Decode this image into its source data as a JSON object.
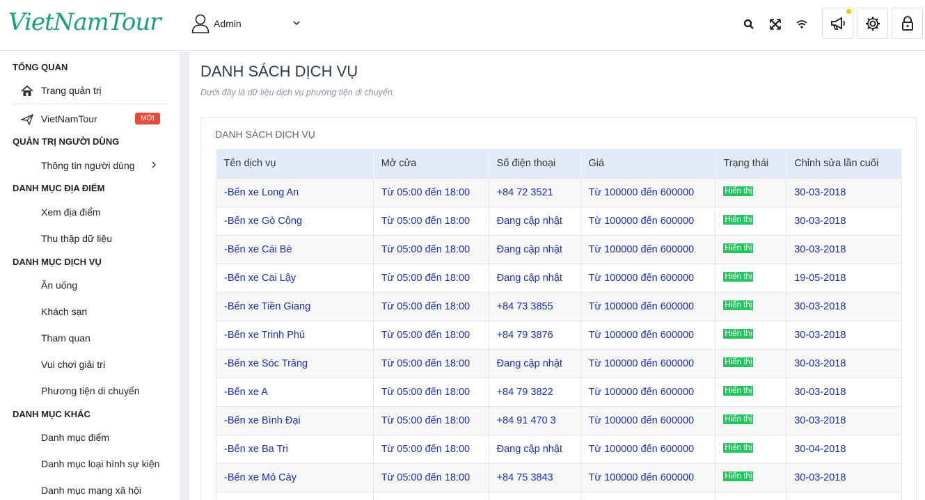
{
  "header": {
    "logo": "VietNamTour",
    "user_name": "Admin",
    "icons": [
      "search-icon",
      "fullscreen-icon",
      "wifi-icon",
      "megaphone-icon",
      "settings-icon",
      "lock-icon"
    ],
    "notif_color": "#f2c400"
  },
  "sidebar": {
    "sections": {
      "overview": "TỔNG QUAN",
      "users": "QUẢN TRỊ NGƯỜI DÙNG",
      "places": "DANH MỤC ĐỊA ĐIỂM",
      "services": "DANH MỤC DỊCH VỤ",
      "other": "DANH MỤC KHÁC"
    },
    "items": {
      "dashboard": "Trang quản trị",
      "vietnamtour": "VietNamTour",
      "new_badge": "MỚI",
      "user_info": "Thông tin người dùng",
      "view_places": "Xem địa điểm",
      "collect_data": "Thu thập dữ liệu",
      "food": "Ăn uống",
      "hotel": "Khách sạn",
      "sightseeing": "Tham quan",
      "entertainment": "Vui chơi giải trí",
      "transport": "Phương tiện di chuyển",
      "points": "Danh mục điểm",
      "event_types": "Danh mục loại hình sự kiện",
      "social": "Danh mục mạng xã hội"
    }
  },
  "main": {
    "title": "DANH SÁCH DỊCH VỤ",
    "subtitle": "Dưới đây là dữ liệu dịch vụ phương tiện di chuyển.",
    "card_title": "DANH SÁCH DỊCH VỤ",
    "columns": [
      "Tên dịch vụ",
      "Mở cửa",
      "Số điện thoại",
      "Giá",
      "Trạng thái",
      "Chỉnh sửa lần cuối"
    ],
    "rows": [
      [
        "-Bến xe Long An",
        "Từ 05:00 đến 18:00",
        "+84 72 3521",
        "Từ 100000 đến 600000",
        "Hiển thị",
        "30-03-2018"
      ],
      [
        "-Bến xe Gò Công",
        "Từ 05:00 đến 18:00",
        "Đang cập nhật",
        "Từ 100000 đến 600000",
        "Hiển thị",
        "30-03-2018"
      ],
      [
        "-Bến xe Cái Bè",
        "Từ 05:00 đến 18:00",
        "Đang cập nhật",
        "Từ 100000 đến 600000",
        "Hiển thị",
        "30-03-2018"
      ],
      [
        "-Bến xe Cai Lậy",
        "Từ 05:00 đến 18:00",
        "Đang cập nhật",
        "Từ 100000 đến 600000",
        "Hiển thị",
        "19-05-2018"
      ],
      [
        "-Bến xe Tiền Giang",
        "Từ 05:00 đến 18:00",
        "+84 73 3855",
        "Từ 100000 đến 600000",
        "Hiển thị",
        "30-03-2018"
      ],
      [
        "-Bến xe Trinh Phú",
        "Từ 05:00 đến 18:00",
        "+84 79 3876",
        "Từ 100000 đến 600000",
        "Hiển thị",
        "30-03-2018"
      ],
      [
        "-Bến xe Sóc Trăng",
        "Từ 05:00 đến 18:00",
        "Đang cập nhật",
        "Từ 100000 đến 600000",
        "Hiển thị",
        "30-03-2018"
      ],
      [
        "-Bến xe A",
        "Từ 05:00 đến 18:00",
        "+84 79 3822",
        "Từ 100000 đến 600000",
        "Hiển thị",
        "30-03-2018"
      ],
      [
        "-Bến xe Bình Đại",
        "Từ 05:00 đến 18:00",
        "+84 91 470 3",
        "Từ 100000 đến 600000",
        "Hiển thị",
        "30-03-2018"
      ],
      [
        "-Bến xe Ba Tri",
        "Từ 05:00 đến 18:00",
        "Đang cập nhật",
        "Từ 100000 đến 600000",
        "Hiển thị",
        "30-04-2018"
      ],
      [
        "-Bến xe Mỏ Cày",
        "Từ 05:00 đến 18:00",
        "+84 75 3843",
        "Từ 100000 đến 600000",
        "Hiển thị",
        "30-03-2018"
      ],
      [
        "",
        "",
        "",
        "",
        "",
        ""
      ]
    ]
  }
}
